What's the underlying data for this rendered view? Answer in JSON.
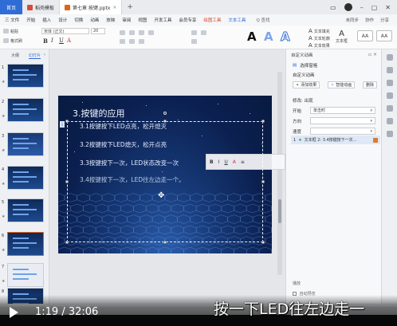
{
  "titlebar": {
    "home": "首页",
    "tabs": [
      {
        "label": "稻壳模板",
        "icon": "docer-icon",
        "color": "#d94a3c"
      },
      {
        "label": "第七章 按键.pptx",
        "icon": "ppt-file-icon",
        "color": "#e0621b"
      }
    ],
    "new_tab": "+",
    "window_controls": [
      "minimize-icon",
      "restore-icon",
      "close-icon"
    ]
  },
  "menubar": {
    "items": [
      "三 文件",
      "开始",
      "插入",
      "设计",
      "切换",
      "动画",
      "放映",
      "审阅",
      "视图",
      "开发工具",
      "会员专享",
      "绘图工具",
      "文本工具"
    ],
    "accent_item": "绘图工具",
    "blue_item": "文本工具",
    "search": "Q 查找",
    "right": [
      "未同步",
      "协作",
      "分享"
    ]
  },
  "ribbon": {
    "paste": "粘贴",
    "format_painter": "格式刷",
    "font_name": "宋体 (正文)",
    "font_size": "20",
    "style_letters": [
      "A",
      "A",
      "A"
    ],
    "text_fill": "文本填充",
    "text_outline": "文本轮廓",
    "text_effect": "文本效果",
    "textbox": "文本框",
    "aa": "AA"
  },
  "left_panel": {
    "tabs": [
      "大纲",
      "幻灯片"
    ],
    "active_tab": "幻灯片",
    "slide_numbers": [
      "1",
      "2",
      "3",
      "4",
      "5",
      "6",
      "7",
      "8"
    ]
  },
  "slide": {
    "title": "3.按键的应用",
    "lines": [
      "3.1按键按下LED点亮，松开熄灭",
      "3.2按键按下LED熄灭，松开点亮",
      "3.3按键按下一次，LED状态改变一次",
      "3.4按键按下一次，LED往左边走一个。"
    ]
  },
  "float_toolbar": {
    "items": [
      "B",
      "I",
      "U",
      "A",
      "≡"
    ]
  },
  "right_pane": {
    "header": "自定义动画",
    "select_pane": "选择窗格",
    "custom_animation": "自定义动画",
    "add_effect": "添加效果",
    "smart_animation": "智能动画",
    "delete": "删除",
    "modify_label": "修改: 出现",
    "start_label": "开始",
    "start_value": "单击时",
    "property_label": "方向",
    "speed_label": "速度",
    "item": "文本框 2: 3.4按键按下一次...",
    "replay": "播放",
    "autopreview": "自动预览"
  },
  "video": {
    "time": "1:19 / 32:06",
    "subtitle": "按一下LED往左边走一"
  }
}
